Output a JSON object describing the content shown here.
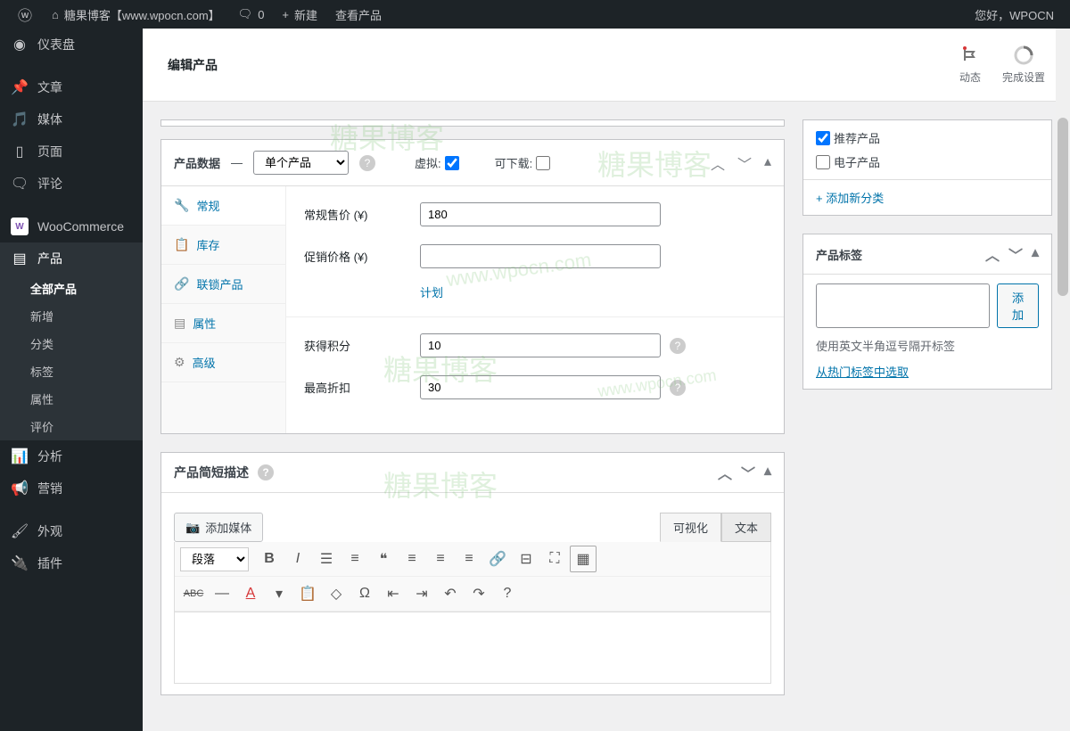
{
  "toolbar": {
    "site_name": "糖果博客【www.wpocn.com】",
    "comments": "0",
    "new": "新建",
    "view_product": "查看产品",
    "greeting": "您好，WPOCN"
  },
  "sidebar": {
    "items": [
      {
        "label": "仪表盘"
      },
      {
        "label": "文章"
      },
      {
        "label": "媒体"
      },
      {
        "label": "页面"
      },
      {
        "label": "评论"
      },
      {
        "label": "WooCommerce"
      },
      {
        "label": "产品"
      },
      {
        "label": "分析"
      },
      {
        "label": "营销"
      },
      {
        "label": "外观"
      },
      {
        "label": "插件"
      }
    ],
    "submenu": [
      {
        "label": "全部产品"
      },
      {
        "label": "新增"
      },
      {
        "label": "分类"
      },
      {
        "label": "标签"
      },
      {
        "label": "属性"
      },
      {
        "label": "评价"
      }
    ]
  },
  "header": {
    "title": "编辑产品",
    "activity": "动态",
    "setup": "完成设置"
  },
  "product_data": {
    "title": "产品数据",
    "type_option": "单个产品",
    "virtual": "虚拟:",
    "downloadable": "可下载:",
    "tabs": {
      "general": "常规",
      "stock": "库存",
      "linked": "联锁产品",
      "attributes": "属性",
      "advanced": "高级"
    },
    "fields": {
      "regular_price_label": "常规售价 (¥)",
      "regular_price_value": "180",
      "sale_price_label": "促销价格 (¥)",
      "sale_price_value": "",
      "schedule": "计划",
      "points_label": "获得积分",
      "points_value": "10",
      "discount_label": "最高折扣",
      "discount_value": "30"
    }
  },
  "short_desc": {
    "title": "产品简短描述",
    "add_media": "添加媒体",
    "tab_visual": "可视化",
    "tab_text": "文本",
    "paragraph": "段落"
  },
  "categories": {
    "featured": "推荐产品",
    "electronic": "电子产品",
    "add_new": "+ 添加新分类"
  },
  "tags": {
    "title": "产品标签",
    "add_btn": "添加",
    "hint": "使用英文半角逗号隔开标签",
    "popular": "从热门标签中选取"
  }
}
